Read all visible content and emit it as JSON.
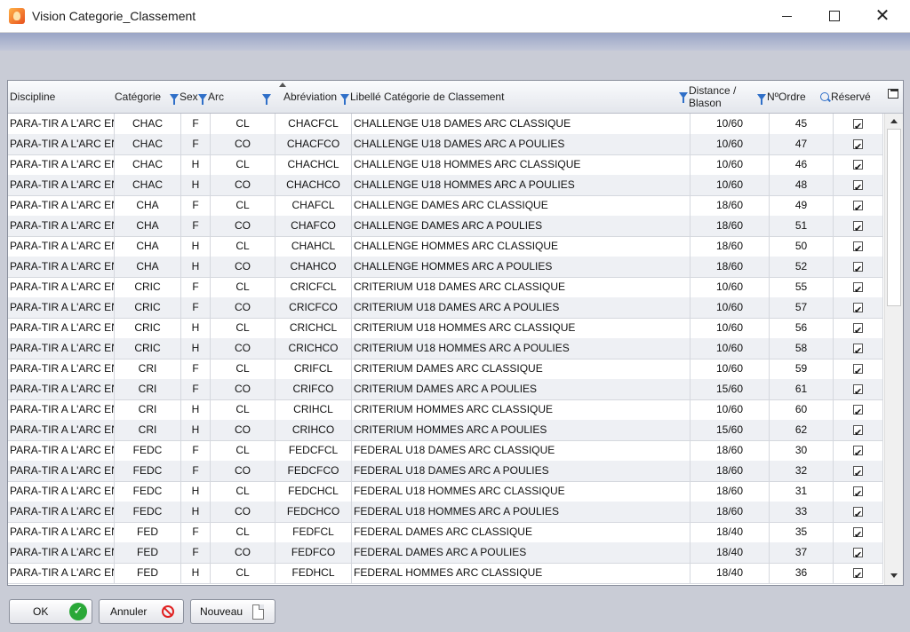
{
  "window": {
    "title": "Vision Categorie_Classement"
  },
  "grid": {
    "columns": [
      {
        "key": "discipline",
        "label": "Discipline"
      },
      {
        "key": "categorie",
        "label": "Catégorie"
      },
      {
        "key": "sexe",
        "label": "Sexe"
      },
      {
        "key": "arc",
        "label": "Arc"
      },
      {
        "key": "abreviation",
        "label": "Abréviation"
      },
      {
        "key": "libelle",
        "label": "Libellé Catégorie de Classement"
      },
      {
        "key": "distance",
        "label": "Distance / Blason"
      },
      {
        "key": "ordre",
        "label": "NºOrdre"
      },
      {
        "key": "reserve",
        "label": "Réservé"
      }
    ],
    "rows": [
      {
        "discipline": "PARA-TIR A L'ARC EN",
        "categorie": "CHAC",
        "sexe": "F",
        "arc": "CL",
        "abreviation": "CHACFCL",
        "libelle": "CHALLENGE U18 DAMES ARC CLASSIQUE",
        "distance": "10/60",
        "ordre": "45",
        "reserve": true
      },
      {
        "discipline": "PARA-TIR A L'ARC EN",
        "categorie": "CHAC",
        "sexe": "F",
        "arc": "CO",
        "abreviation": "CHACFCO",
        "libelle": "CHALLENGE U18 DAMES ARC A POULIES",
        "distance": "10/60",
        "ordre": "47",
        "reserve": true
      },
      {
        "discipline": "PARA-TIR A L'ARC EN",
        "categorie": "CHAC",
        "sexe": "H",
        "arc": "CL",
        "abreviation": "CHACHCL",
        "libelle": "CHALLENGE U18 HOMMES ARC CLASSIQUE",
        "distance": "10/60",
        "ordre": "46",
        "reserve": true
      },
      {
        "discipline": "PARA-TIR A L'ARC EN",
        "categorie": "CHAC",
        "sexe": "H",
        "arc": "CO",
        "abreviation": "CHACHCO",
        "libelle": "CHALLENGE U18 HOMMES ARC A POULIES",
        "distance": "10/60",
        "ordre": "48",
        "reserve": true
      },
      {
        "discipline": "PARA-TIR A L'ARC EN",
        "categorie": "CHA",
        "sexe": "F",
        "arc": "CL",
        "abreviation": "CHAFCL",
        "libelle": "CHALLENGE DAMES ARC CLASSIQUE",
        "distance": "18/60",
        "ordre": "49",
        "reserve": true
      },
      {
        "discipline": "PARA-TIR A L'ARC EN",
        "categorie": "CHA",
        "sexe": "F",
        "arc": "CO",
        "abreviation": "CHAFCO",
        "libelle": "CHALLENGE DAMES ARC A POULIES",
        "distance": "18/60",
        "ordre": "51",
        "reserve": true
      },
      {
        "discipline": "PARA-TIR A L'ARC EN",
        "categorie": "CHA",
        "sexe": "H",
        "arc": "CL",
        "abreviation": "CHAHCL",
        "libelle": "CHALLENGE HOMMES ARC CLASSIQUE",
        "distance": "18/60",
        "ordre": "50",
        "reserve": true
      },
      {
        "discipline": "PARA-TIR A L'ARC EN",
        "categorie": "CHA",
        "sexe": "H",
        "arc": "CO",
        "abreviation": "CHAHCO",
        "libelle": "CHALLENGE HOMMES ARC A POULIES",
        "distance": "18/60",
        "ordre": "52",
        "reserve": true
      },
      {
        "discipline": "PARA-TIR A L'ARC EN",
        "categorie": "CRIC",
        "sexe": "F",
        "arc": "CL",
        "abreviation": "CRICFCL",
        "libelle": "CRITERIUM U18 DAMES ARC CLASSIQUE",
        "distance": "10/60",
        "ordre": "55",
        "reserve": true
      },
      {
        "discipline": "PARA-TIR A L'ARC EN",
        "categorie": "CRIC",
        "sexe": "F",
        "arc": "CO",
        "abreviation": "CRICFCO",
        "libelle": "CRITERIUM U18 DAMES ARC A POULIES",
        "distance": "10/60",
        "ordre": "57",
        "reserve": true
      },
      {
        "discipline": "PARA-TIR A L'ARC EN",
        "categorie": "CRIC",
        "sexe": "H",
        "arc": "CL",
        "abreviation": "CRICHCL",
        "libelle": "CRITERIUM U18 HOMMES ARC CLASSIQUE",
        "distance": "10/60",
        "ordre": "56",
        "reserve": true
      },
      {
        "discipline": "PARA-TIR A L'ARC EN",
        "categorie": "CRIC",
        "sexe": "H",
        "arc": "CO",
        "abreviation": "CRICHCO",
        "libelle": "CRITERIUM U18 HOMMES ARC A POULIES",
        "distance": "10/60",
        "ordre": "58",
        "reserve": true
      },
      {
        "discipline": "PARA-TIR A L'ARC EN",
        "categorie": "CRI",
        "sexe": "F",
        "arc": "CL",
        "abreviation": "CRIFCL",
        "libelle": "CRITERIUM DAMES ARC CLASSIQUE",
        "distance": "10/60",
        "ordre": "59",
        "reserve": true
      },
      {
        "discipline": "PARA-TIR A L'ARC EN",
        "categorie": "CRI",
        "sexe": "F",
        "arc": "CO",
        "abreviation": "CRIFCO",
        "libelle": "CRITERIUM DAMES ARC A POULIES",
        "distance": "15/60",
        "ordre": "61",
        "reserve": true
      },
      {
        "discipline": "PARA-TIR A L'ARC EN",
        "categorie": "CRI",
        "sexe": "H",
        "arc": "CL",
        "abreviation": "CRIHCL",
        "libelle": "CRITERIUM HOMMES ARC CLASSIQUE",
        "distance": "10/60",
        "ordre": "60",
        "reserve": true
      },
      {
        "discipline": "PARA-TIR A L'ARC EN",
        "categorie": "CRI",
        "sexe": "H",
        "arc": "CO",
        "abreviation": "CRIHCO",
        "libelle": "CRITERIUM HOMMES ARC A POULIES",
        "distance": "15/60",
        "ordre": "62",
        "reserve": true
      },
      {
        "discipline": "PARA-TIR A L'ARC EN",
        "categorie": "FEDC",
        "sexe": "F",
        "arc": "CL",
        "abreviation": "FEDCFCL",
        "libelle": "FEDERAL U18 DAMES ARC CLASSIQUE",
        "distance": "18/60",
        "ordre": "30",
        "reserve": true
      },
      {
        "discipline": "PARA-TIR A L'ARC EN",
        "categorie": "FEDC",
        "sexe": "F",
        "arc": "CO",
        "abreviation": "FEDCFCO",
        "libelle": "FEDERAL U18 DAMES ARC A POULIES",
        "distance": "18/60",
        "ordre": "32",
        "reserve": true
      },
      {
        "discipline": "PARA-TIR A L'ARC EN",
        "categorie": "FEDC",
        "sexe": "H",
        "arc": "CL",
        "abreviation": "FEDCHCL",
        "libelle": "FEDERAL U18 HOMMES ARC CLASSIQUE",
        "distance": "18/60",
        "ordre": "31",
        "reserve": true
      },
      {
        "discipline": "PARA-TIR A L'ARC EN",
        "categorie": "FEDC",
        "sexe": "H",
        "arc": "CO",
        "abreviation": "FEDCHCO",
        "libelle": "FEDERAL U18 HOMMES ARC A POULIES",
        "distance": "18/60",
        "ordre": "33",
        "reserve": true
      },
      {
        "discipline": "PARA-TIR A L'ARC EN",
        "categorie": "FED",
        "sexe": "F",
        "arc": "CL",
        "abreviation": "FEDFCL",
        "libelle": "FEDERAL DAMES ARC CLASSIQUE",
        "distance": "18/40",
        "ordre": "35",
        "reserve": true
      },
      {
        "discipline": "PARA-TIR A L'ARC EN",
        "categorie": "FED",
        "sexe": "F",
        "arc": "CO",
        "abreviation": "FEDFCO",
        "libelle": "FEDERAL DAMES ARC A POULIES",
        "distance": "18/40",
        "ordre": "37",
        "reserve": true
      },
      {
        "discipline": "PARA-TIR A L'ARC EN",
        "categorie": "FED",
        "sexe": "H",
        "arc": "CL",
        "abreviation": "FEDHCL",
        "libelle": "FEDERAL HOMMES ARC CLASSIQUE",
        "distance": "18/40",
        "ordre": "36",
        "reserve": true
      }
    ]
  },
  "buttons": {
    "ok": "OK",
    "annuler": "Annuler",
    "nouveau": "Nouveau"
  },
  "colors": {
    "accent": "#2f6fc8",
    "ok_green": "#2aa838",
    "cancel_red": "#e02020",
    "row_alt": "#eef0f4"
  }
}
